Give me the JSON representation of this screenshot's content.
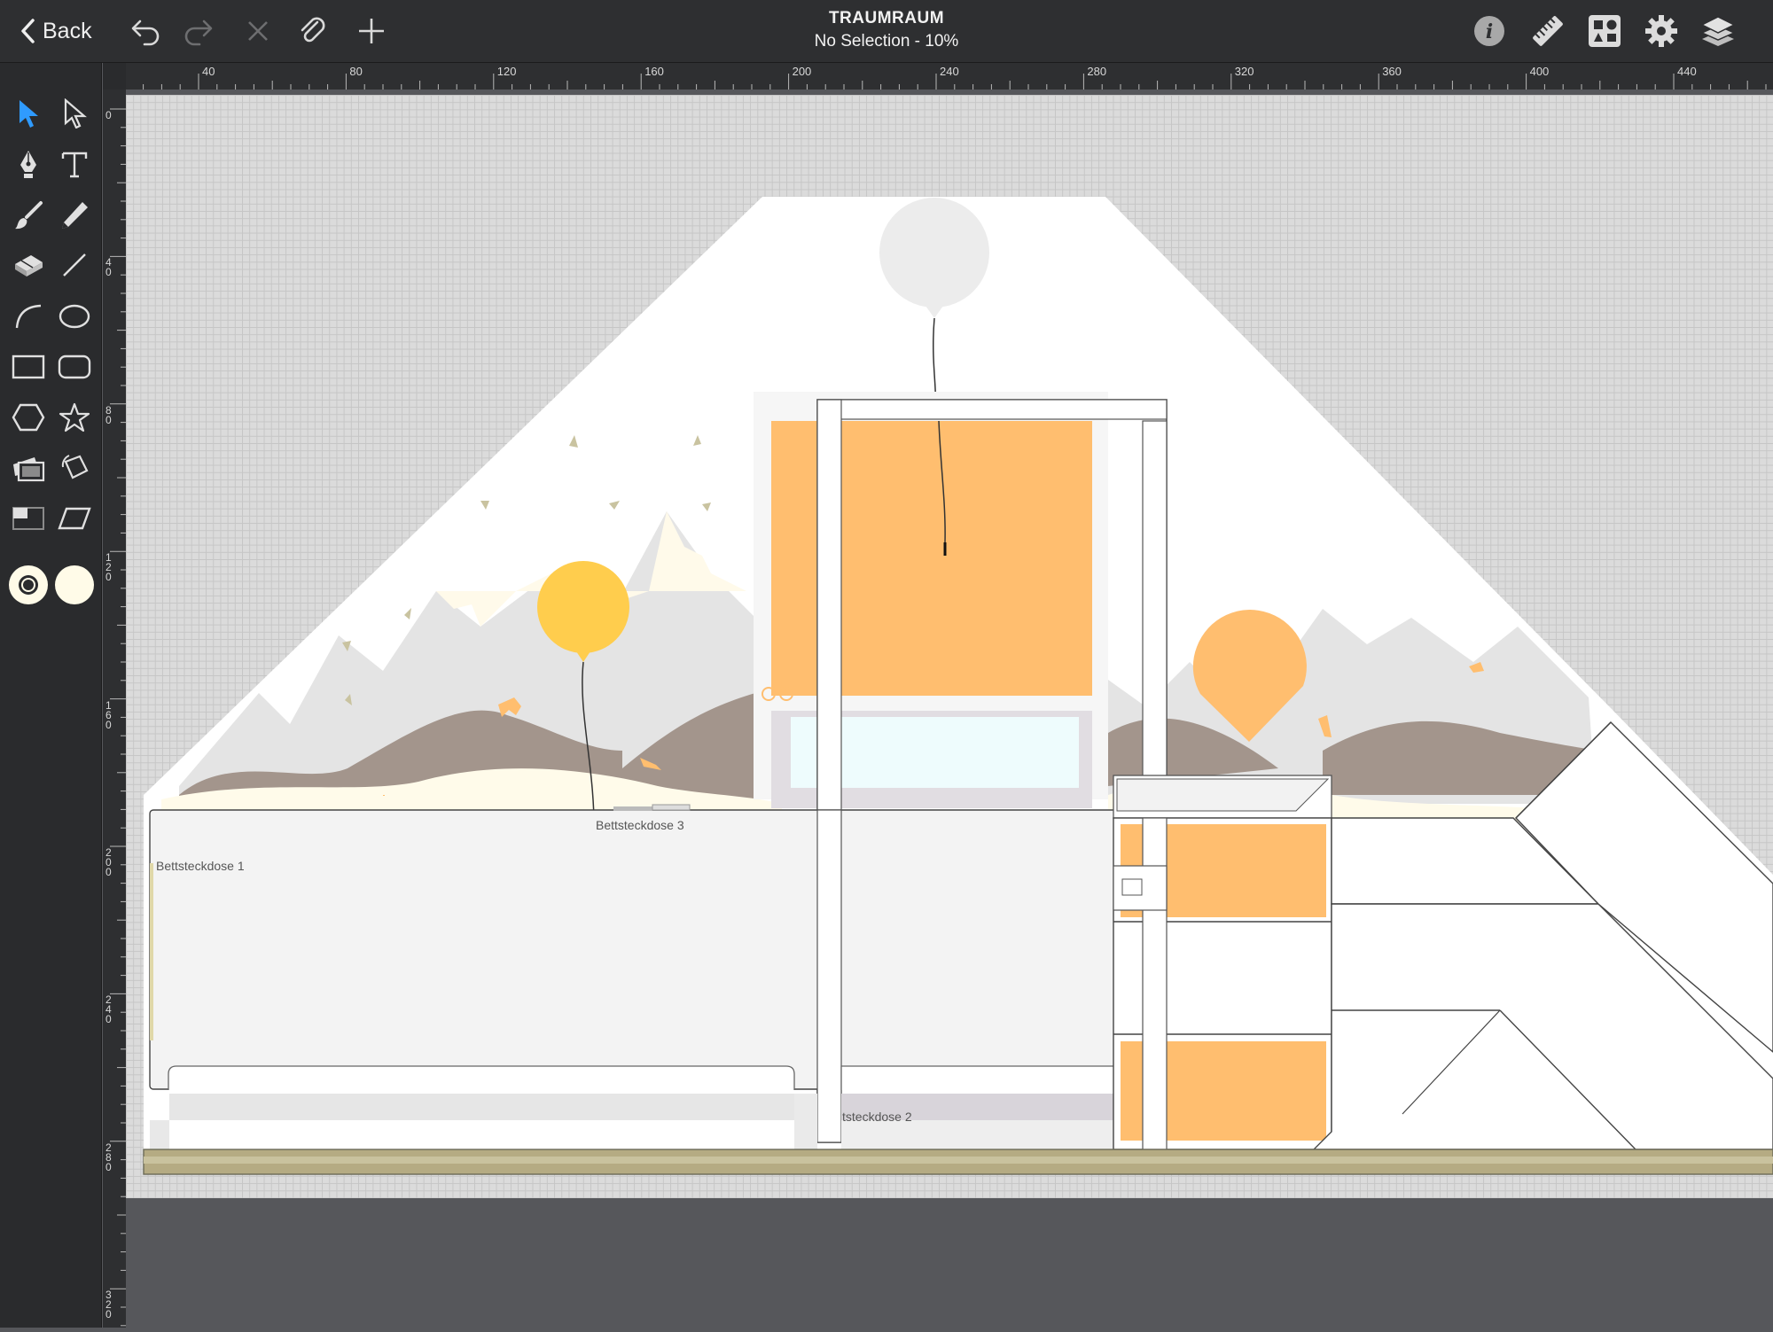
{
  "toolbar": {
    "back_label": "Back",
    "title": "TRAUMRAUM",
    "status": "No Selection - 10%",
    "left_icons": [
      "undo-icon",
      "redo-icon",
      "delete-icon",
      "attach-icon",
      "add-icon"
    ],
    "right_icons": [
      "info-icon",
      "ruler-icon",
      "shapes-library-icon",
      "settings-icon",
      "layers-icon"
    ]
  },
  "tools": [
    "selection-arrow",
    "direct-selection-arrow",
    "pen",
    "text",
    "brush",
    "pencil",
    "eraser",
    "line",
    "arc",
    "ellipse",
    "rectangle",
    "rounded-rectangle",
    "hexagon",
    "star",
    "image",
    "transform",
    "frame",
    "parallelogram"
  ],
  "style_swatches": {
    "stroke": "#fffbe8",
    "fill": "#fffbe8"
  },
  "rulers": {
    "horizontal": [
      "40",
      "80",
      "120",
      "160",
      "200",
      "240",
      "280",
      "320",
      "360",
      "400",
      "440"
    ],
    "vertical": [
      "0",
      "40",
      "80",
      "120",
      "160",
      "200",
      "240",
      "280",
      "320"
    ]
  },
  "drawing": {
    "labels": {
      "socket1": "Bettsteckdose 1",
      "socket2": "tsteckdose 2",
      "socket3": "Bettsteckdose 3"
    }
  },
  "colors": {
    "accent_blue": "#2f9bff",
    "orange": "#ffbe6f",
    "yellow": "#ffcd4d",
    "mountain_gray": "#e3e3e3",
    "hill_brown": "#a3958c",
    "floor": "#b5ab83"
  }
}
